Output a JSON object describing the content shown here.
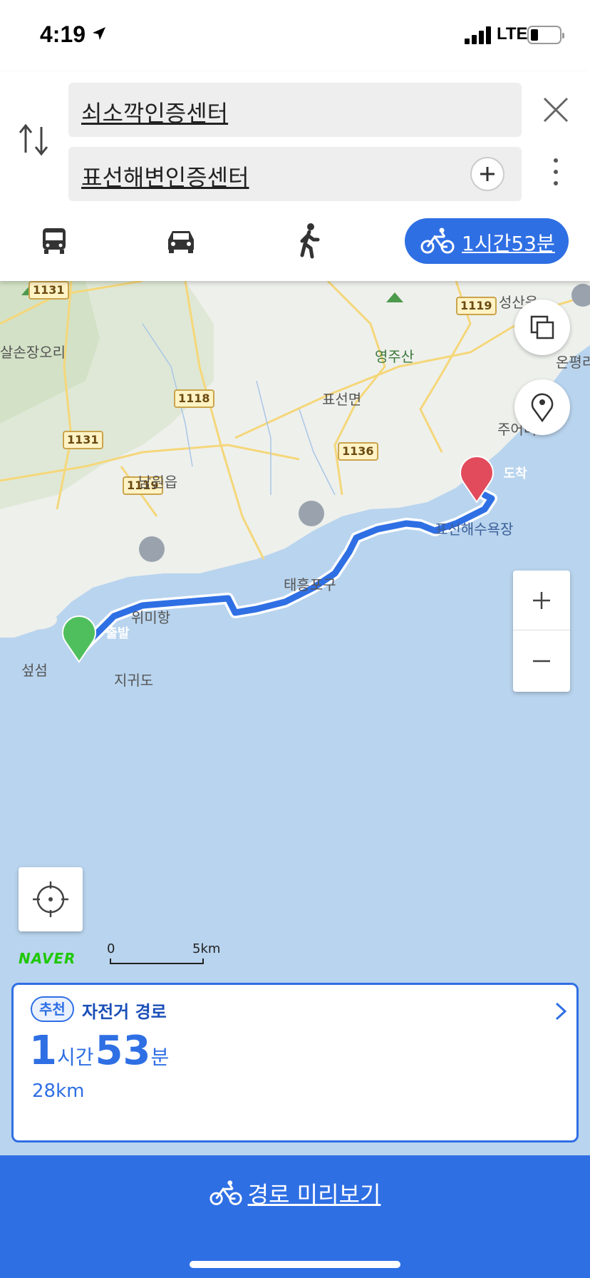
{
  "status_bar": {
    "time": "4:19",
    "network": "LTE"
  },
  "search": {
    "origin": "쇠소깍인증센터",
    "destination": "표선해변인증센터"
  },
  "transport_modes": {
    "active": "bicycle",
    "bike_duration": "1시간53분",
    "icons": [
      "bus-icon",
      "car-icon",
      "walk-icon",
      "bicycle-icon"
    ]
  },
  "map": {
    "labels": {
      "seongsan": "성산읍",
      "onpyeong": "온평리",
      "yeongjusan": "영주산",
      "salson": "살손장오리",
      "pyoseon_myeon": "표선면",
      "juari": "주어리",
      "namwon": "남원읍",
      "beach": "표선해수욕장",
      "taeheung": "태흥포구",
      "wimi": "위미항",
      "seopseom": "섶섬",
      "jigwido": "지귀도"
    },
    "road_shields": [
      "1131",
      "1119",
      "1118",
      "1131",
      "1136",
      "1119"
    ],
    "start_pin": "출발",
    "end_pin": "도착",
    "scale": {
      "start": "0",
      "end": "5km"
    },
    "brand": "NAVER"
  },
  "route_card": {
    "badge": "추천",
    "title": "자전거 경로",
    "hours": "1",
    "hours_unit": "시간",
    "minutes": "53",
    "minutes_unit": "분",
    "distance": "28km"
  },
  "bottom": {
    "preview_label": "경로 미리보기"
  },
  "colors": {
    "accent": "#2f6fe4",
    "start": "#4fbf5d",
    "end": "#e24b5b",
    "water": "#b9d4ee",
    "land": "#eef0ec"
  }
}
